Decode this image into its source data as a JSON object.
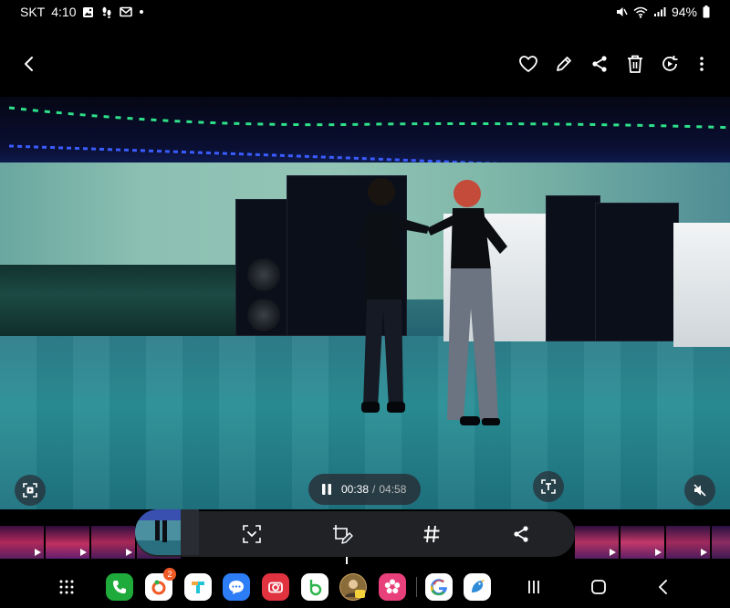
{
  "status_bar": {
    "carrier": "SKT",
    "time": "4:10",
    "battery": "94%",
    "left_icons": [
      "image-icon",
      "footprint-icon",
      "mail-icon",
      "dot-icon"
    ],
    "right_icons": [
      "mute-icon",
      "wifi-icon",
      "signal-icon",
      "battery-icon"
    ]
  },
  "toolbar": {
    "icons": [
      "back-icon",
      "heart-icon",
      "edit-icon",
      "share-icon",
      "trash-icon",
      "remaster-icon",
      "more-icon"
    ]
  },
  "player": {
    "current_time": "00:38",
    "separator": "/",
    "duration": "04:58",
    "overlay_icons": [
      "capture-icon",
      "text-extract-icon",
      "mute-icon",
      "pause-icon"
    ]
  },
  "actions": {
    "icons": [
      "smart-select-icon",
      "edit-clip-icon",
      "hashtag-icon",
      "share-icon"
    ]
  },
  "taskbar": {
    "apps": [
      {
        "name": "phone",
        "color": "#1faa3c"
      },
      {
        "name": "app-with-badge",
        "color": "#ffffff",
        "badge": "2"
      },
      {
        "name": "t-app",
        "color": "#ffffff"
      },
      {
        "name": "messages",
        "color": "#2d7df6"
      },
      {
        "name": "camera",
        "color": "#e1323f"
      },
      {
        "name": "b-app",
        "color": "#ffffff"
      },
      {
        "name": "avatar-app",
        "color": "#c9a25b"
      },
      {
        "name": "flower-app",
        "color": "#e8407a"
      },
      {
        "name": "google",
        "color": "#ffffff"
      },
      {
        "name": "bird-app",
        "color": "#ffffff"
      }
    ]
  },
  "colors": {
    "background": "#000000",
    "pill": "#282c34",
    "accent_green": "#2fe08a",
    "accent_blue": "#3a5cff"
  }
}
